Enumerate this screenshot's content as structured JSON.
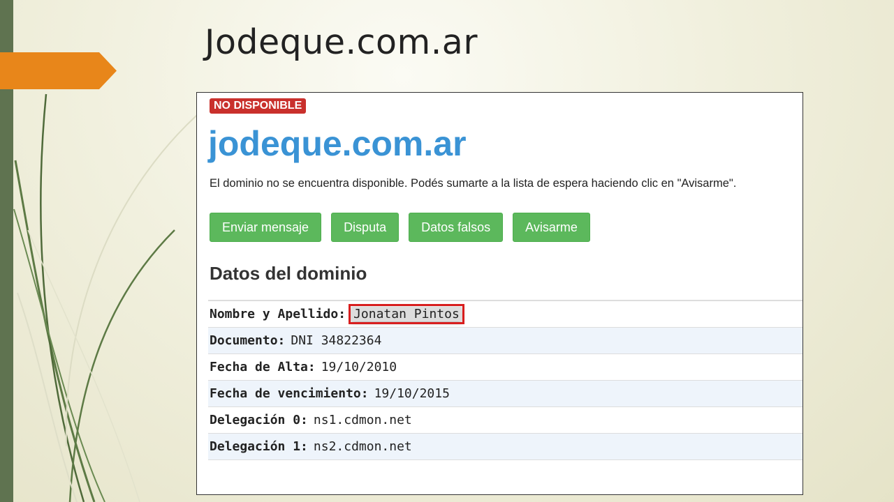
{
  "slide": {
    "title": "Jodeque.com.ar"
  },
  "colors": {
    "accent_orange": "#e8861a",
    "sidebar_green": "#5f7350",
    "badge_red": "#c9302c",
    "domain_blue": "#3a93d5",
    "button_green": "#5cb85c"
  },
  "screenshot": {
    "badge": "NO DISPONIBLE",
    "domain": "jodeque.com.ar",
    "message": "El dominio no se encuentra disponible. Podés sumarte a la lista de espera haciendo clic en \"Avisarme\".",
    "buttons": [
      "Enviar mensaje",
      "Disputa",
      "Datos falsos",
      "Avisarme"
    ],
    "section_title": "Datos del dominio",
    "rows": [
      {
        "label": "Nombre y Apellido:",
        "value": "Jonatan Pintos"
      },
      {
        "label": "Documento:",
        "value": "DNI 34822364"
      },
      {
        "label": "Fecha de Alta:",
        "value": "19/10/2010"
      },
      {
        "label": "Fecha de vencimiento:",
        "value": "19/10/2015"
      },
      {
        "label": "Delegación 0:",
        "value": "ns1.cdmon.net"
      },
      {
        "label": "Delegación 1:",
        "value": "ns2.cdmon.net"
      }
    ]
  }
}
